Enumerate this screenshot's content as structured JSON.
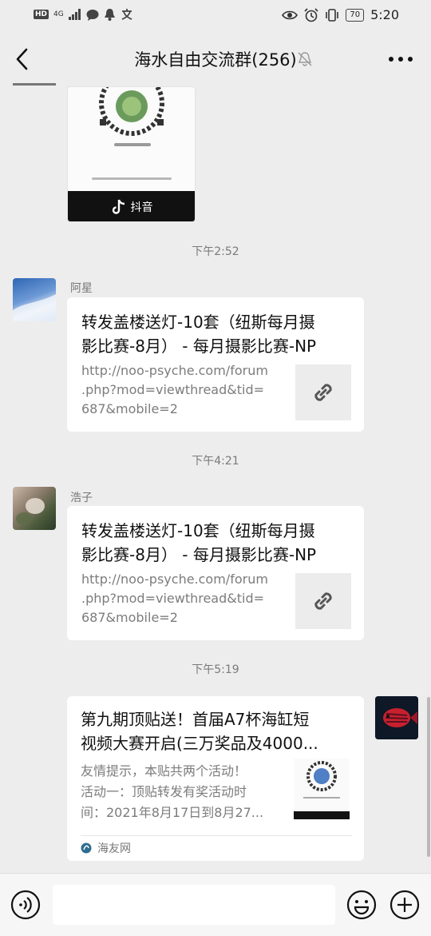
{
  "status_bar": {
    "network": "4G",
    "battery": "70",
    "time": "5:20"
  },
  "header": {
    "title": "海水自由交流群(256)"
  },
  "messages": [
    {
      "type": "image",
      "logo_text": "抖音"
    },
    {
      "type": "timestamp",
      "text": "下午2:52"
    },
    {
      "type": "link",
      "sender": "阿星",
      "title_line1": "转发盖楼送灯-10套（纽斯每月摄",
      "title_line2": "影比赛-8月） - 每月摄影比赛-NP",
      "desc_line1": "http://noo-psyche.com/forum",
      "desc_line2": ".php?mod=viewthread&tid=",
      "desc_line3": "687&mobile=2"
    },
    {
      "type": "timestamp",
      "text": "下午4:21"
    },
    {
      "type": "link",
      "sender": "浩子",
      "title_line1": "转发盖楼送灯-10套（纽斯每月摄",
      "title_line2": "影比赛-8月） - 每月摄影比赛-NP",
      "desc_line1": "http://noo-psyche.com/forum",
      "desc_line2": ".php?mod=viewthread&tid=",
      "desc_line3": "687&mobile=2"
    },
    {
      "type": "timestamp",
      "text": "下午5:19"
    },
    {
      "type": "article",
      "title_line1": "第九期顶贴送！首届A7杯海缸短",
      "title_line2": "视频大赛开启(三万奖品及4000...",
      "desc_line1": "友情提示，本贴共两个活动！",
      "desc_line2": "活动一：顶贴转发有奖活动时",
      "desc_line3": "间：2021年8月17日到8月27...",
      "source": "海友网"
    }
  ]
}
